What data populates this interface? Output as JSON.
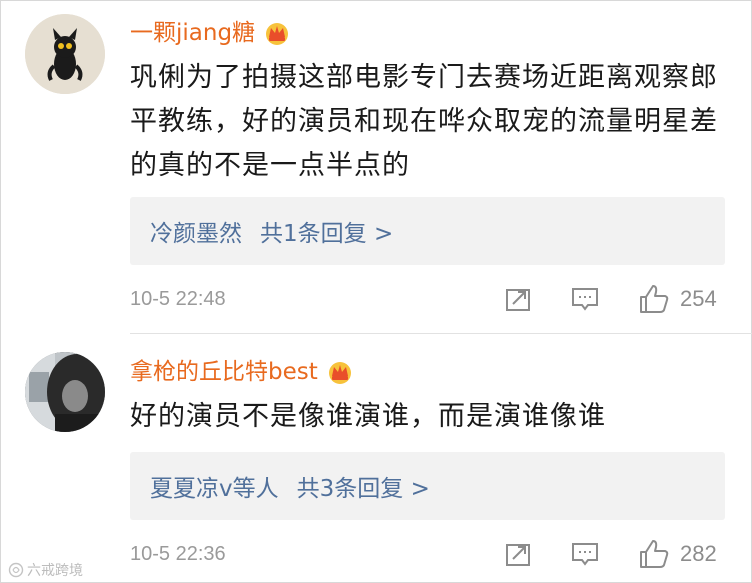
{
  "comments": [
    {
      "username": "一颗jiang糖",
      "text": "巩俐为了拍摄这部电影专门去赛场近距离观察郎平教练，好的演员和现在哗众取宠的流量明星差的真的不是一点半点的",
      "reply_names": "冷颜墨然",
      "reply_count": "共1条回复 >",
      "timestamp": "10-5 22:48",
      "likes": "254"
    },
    {
      "username": "拿枪的丘比特best",
      "text": "好的演员不是像谁演谁，而是演谁像谁",
      "reply_names": "夏夏凉v等人",
      "reply_count": "共3条回复 >",
      "timestamp": "10-5 22:36",
      "likes": "282"
    }
  ],
  "watermark": "六戒跨境",
  "icons": {
    "badge": "crown-badge-icon",
    "share": "share-icon",
    "reply": "comment-icon",
    "like": "thumbs-up-icon"
  },
  "colors": {
    "username": "#e86a1f",
    "reply_link": "#50709b",
    "meta": "#9a9a9a",
    "reply_bg": "#f2f2f2"
  }
}
